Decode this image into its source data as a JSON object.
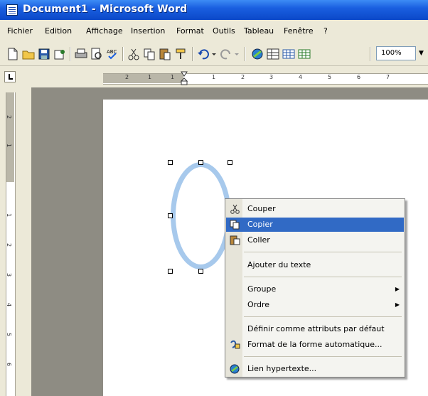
{
  "window": {
    "title": "Document1 - Microsoft Word"
  },
  "menubar": [
    {
      "label": "Fichier"
    },
    {
      "label": "Edition"
    },
    {
      "label": "Affichage"
    },
    {
      "label": "Insertion"
    },
    {
      "label": "Format"
    },
    {
      "label": "Outils"
    },
    {
      "label": "Tableau"
    },
    {
      "label": "Fenêtre"
    },
    {
      "label": "?"
    }
  ],
  "toolbar": {
    "zoom": "100%",
    "icons": [
      "new-document-icon",
      "open-icon",
      "save-icon",
      "permission-icon",
      "print-icon",
      "print-preview-icon",
      "spelling-icon",
      "cut-icon",
      "copy-icon",
      "paste-icon",
      "format-painter-icon",
      "undo-icon",
      "redo-icon",
      "hyperlink-icon",
      "tables-borders-icon",
      "insert-table-icon",
      "insert-excel-icon"
    ]
  },
  "ruler": {
    "h_numbers": [
      "2",
      "1",
      "1",
      "1",
      "2",
      "3",
      "4",
      "5",
      "6",
      "7"
    ],
    "v_numbers": [
      "2",
      "1",
      "1",
      "2",
      "3",
      "4",
      "5",
      "6"
    ]
  },
  "context_menu": {
    "items": [
      {
        "label": "Couper",
        "icon": "scissors-icon"
      },
      {
        "label": "Copier",
        "icon": "copy-icon",
        "highlighted": true
      },
      {
        "label": "Coller",
        "icon": "paste-icon"
      },
      {
        "label": "Ajouter du texte"
      },
      {
        "label": "Groupe",
        "submenu": true
      },
      {
        "label": "Ordre",
        "submenu": true
      },
      {
        "label": "Définir comme attributs par défaut"
      },
      {
        "label": "Format de la forme automatique...",
        "icon": "format-shape-icon"
      },
      {
        "label": "Lien hypertexte...",
        "icon": "hyperlink-icon"
      }
    ]
  },
  "colors": {
    "titlebar": "#0b48c8",
    "menu_highlight": "#316ac5",
    "ellipse_stroke": "#a7c9ec",
    "workspace": "#8e8c83"
  }
}
